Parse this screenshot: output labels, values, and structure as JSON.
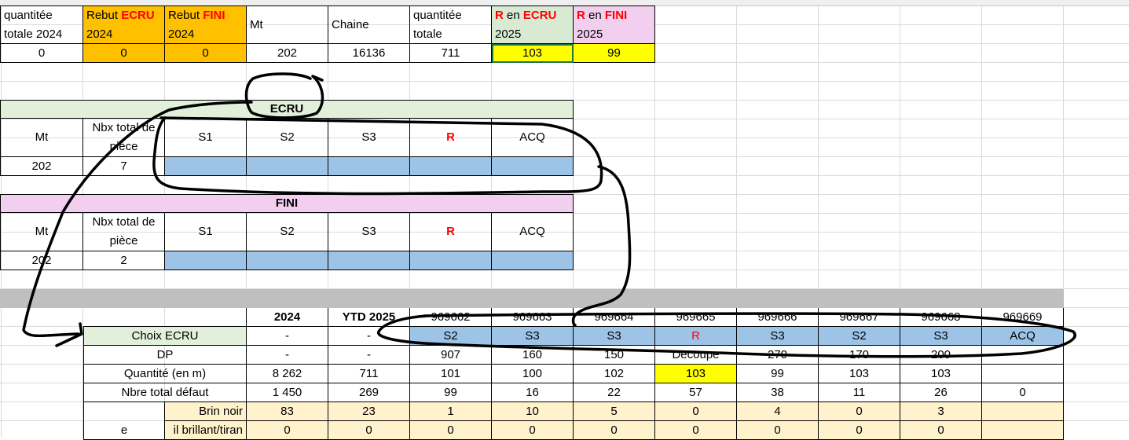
{
  "top": {
    "headers": [
      {
        "l1": "quantitée",
        "l2": "totale 2024"
      },
      {
        "l1a": "Rebut ",
        "l1b": "ECRU",
        "l2": "2024"
      },
      {
        "l1a": "Rebut ",
        "l1b": "FINI",
        "l2": "2024"
      },
      {
        "text": "Mt"
      },
      {
        "text": "Chaine"
      },
      {
        "l1": "quantitée",
        "l2": "totale"
      },
      {
        "l1a": "R",
        "l1m": " en  ",
        "l1b": "ECRU",
        "l2": "2025"
      },
      {
        "l1a": "R",
        "l1m": " en ",
        "l1b": "FINI",
        "l2": "2025"
      }
    ],
    "values": [
      "0",
      "0",
      "0",
      "202",
      "16136",
      "711",
      "103",
      "99"
    ]
  },
  "ecru": {
    "title": "ECRU",
    "mt_label": "Mt",
    "nbx_label": "Nbx total de pièce",
    "cols": [
      "S1",
      "S2",
      "S3",
      "R",
      "ACQ"
    ],
    "mt_value": "202",
    "nbx_value": "7"
  },
  "fini": {
    "title": "FINI",
    "mt_label": "Mt",
    "nbx_label": "Nbx total de pièce",
    "cols": [
      "S1",
      "S2",
      "S3",
      "R",
      "ACQ"
    ],
    "mt_value": "202",
    "nbx_value": "2"
  },
  "bottom": {
    "headers": [
      "2024",
      "YTD 2025",
      "969662",
      "969663",
      "969664",
      "969665",
      "969666",
      "969667",
      "969668",
      "969669"
    ],
    "rows": [
      {
        "label": "Choix ECRU",
        "cells": [
          "-",
          "-",
          "S2",
          "S3",
          "S3",
          "R",
          "S3",
          "S2",
          "S3",
          "ACQ"
        ]
      },
      {
        "label": "DP",
        "cells": [
          "-",
          "-",
          "907",
          "160",
          "150",
          "Decoupe",
          "270",
          "170",
          "200",
          ""
        ]
      },
      {
        "label": "Quantité (en m)",
        "cells": [
          "8 262",
          "711",
          "101",
          "100",
          "102",
          "103",
          "99",
          "103",
          "103",
          ""
        ]
      },
      {
        "label": "Nbre total défaut",
        "cells": [
          "1 450",
          "269",
          "99",
          "16",
          "22",
          "57",
          "38",
          "11",
          "26",
          "0"
        ]
      }
    ],
    "defect_rows": [
      {
        "label": "Brin noir",
        "cells": [
          "83",
          "23",
          "1",
          "10",
          "5",
          "0",
          "4",
          "0",
          "3",
          ""
        ]
      },
      {
        "label": "il brillant/tiran",
        "cells": [
          "0",
          "0",
          "0",
          "0",
          "0",
          "0",
          "0",
          "0",
          "0",
          ""
        ]
      }
    ],
    "side_label": "e"
  },
  "colors": {
    "orange": "#ffc000",
    "yellow": "#ffff00",
    "light_green": "#e2efda",
    "pink": "#f2cfee",
    "blue": "#9dc3e6",
    "cream": "#fff2cc",
    "gray_band": "#bfbfbf",
    "red_text": "#ff0000"
  }
}
